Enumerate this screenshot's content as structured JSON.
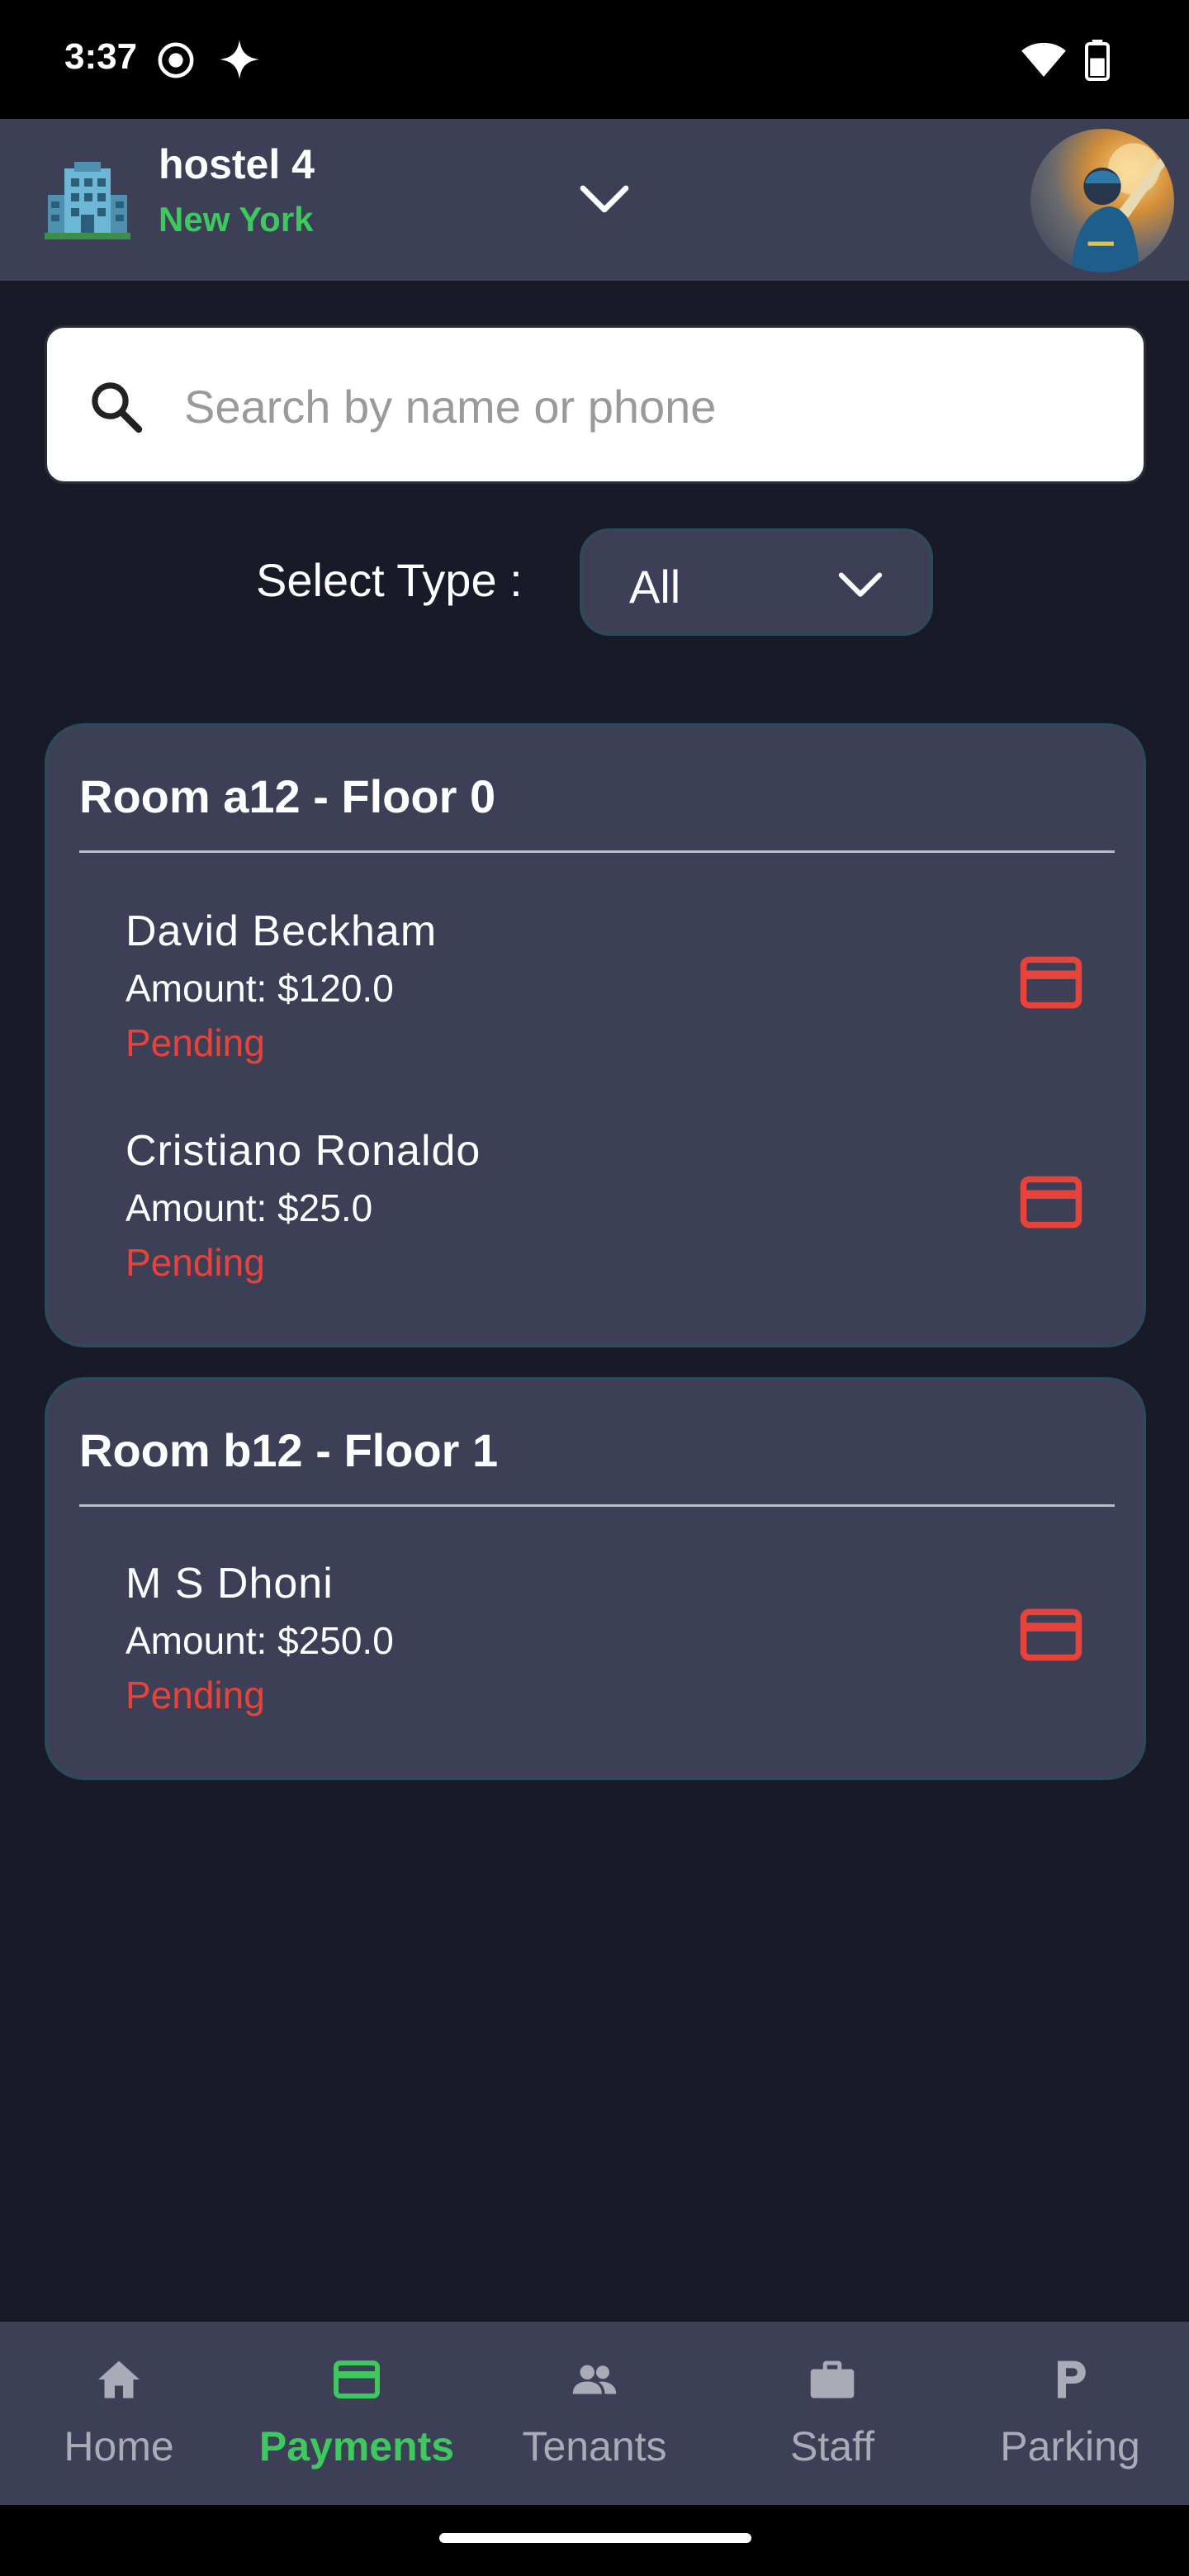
{
  "status_bar": {
    "time": "3:37"
  },
  "header": {
    "hostel_name": "hostel 4",
    "city": "New York",
    "city_color": "#3ec95f"
  },
  "search": {
    "placeholder": "Search by name or phone",
    "value": ""
  },
  "filter": {
    "label": "Select Type :",
    "selected": "All"
  },
  "rooms": [
    {
      "title": "Room a12 - Floor 0",
      "tenants": [
        {
          "name": "David Beckham",
          "amount": "Amount: $120.0",
          "status": "Pending"
        },
        {
          "name": "Cristiano Ronaldo",
          "amount": "Amount: $25.0",
          "status": "Pending"
        }
      ]
    },
    {
      "title": "Room b12 - Floor 1",
      "tenants": [
        {
          "name": "M S Dhoni",
          "amount": "Amount: $250.0",
          "status": "Pending"
        }
      ]
    }
  ],
  "nav": {
    "items": [
      {
        "label": "Home",
        "icon": "home-icon"
      },
      {
        "label": "Payments",
        "icon": "credit-card-icon",
        "active": true
      },
      {
        "label": "Tenants",
        "icon": "people-icon"
      },
      {
        "label": "Staff",
        "icon": "briefcase-icon"
      },
      {
        "label": "Parking",
        "icon": "parking-icon"
      }
    ]
  },
  "colors": {
    "background": "#181a27",
    "surface": "#3c3f55",
    "accent_green": "#3ec95f",
    "pending_red": "#e8433b"
  }
}
